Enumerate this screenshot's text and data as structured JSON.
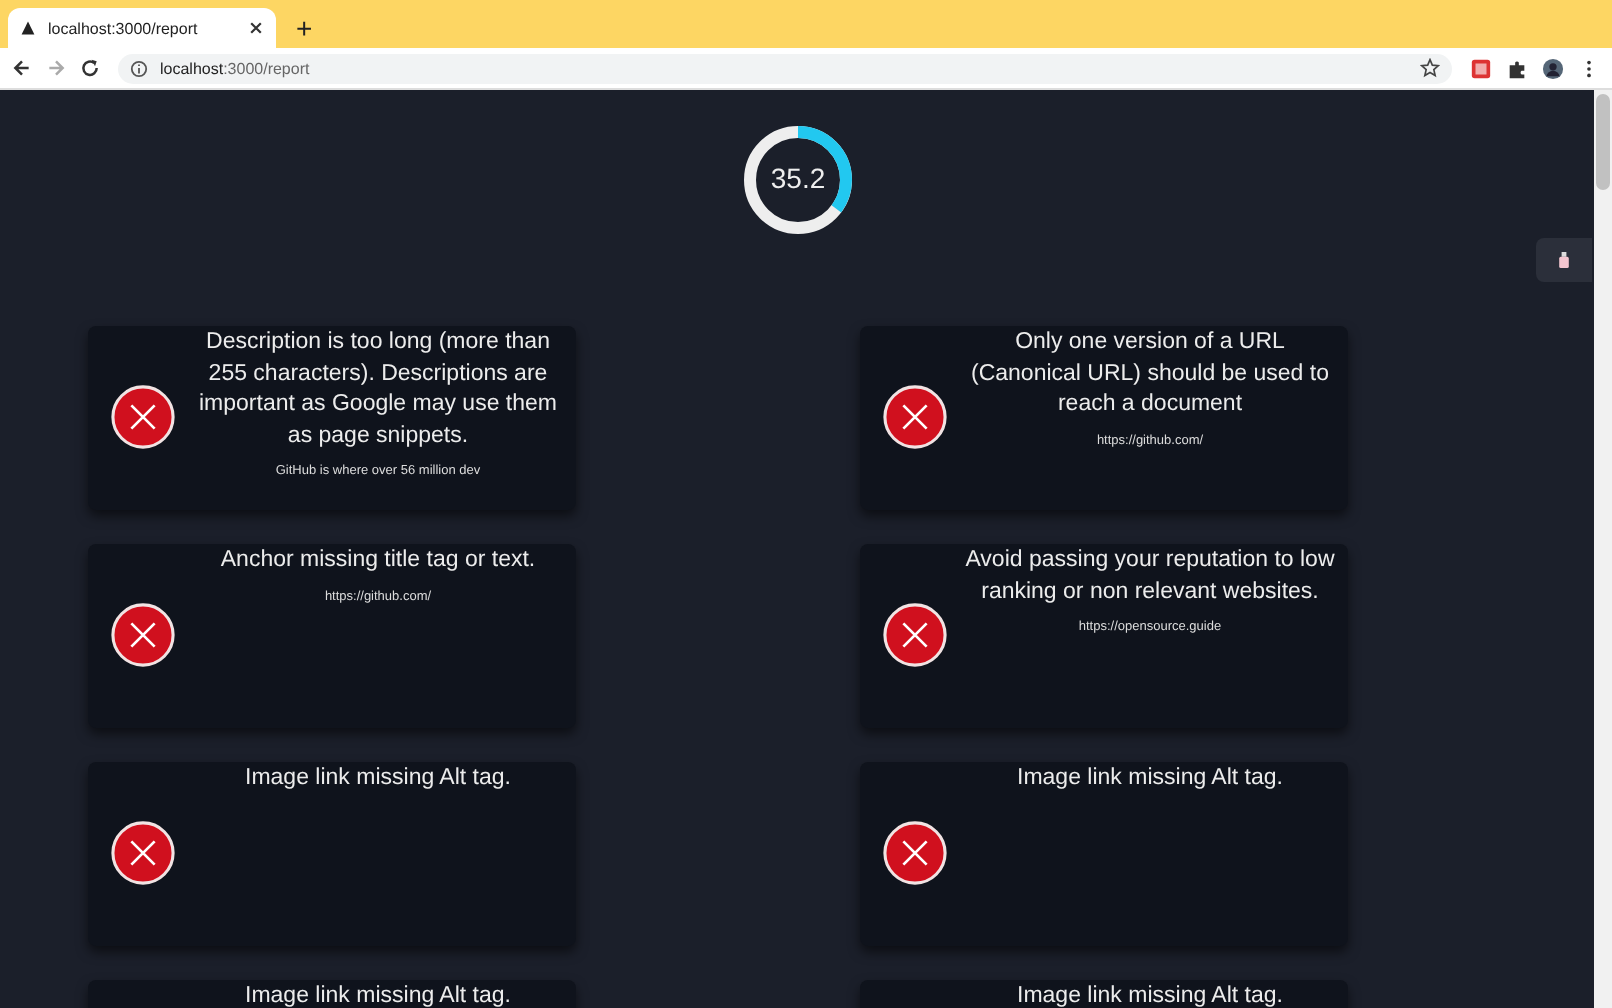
{
  "browser": {
    "tab": {
      "title": "localhost:3000/report",
      "selected": true
    },
    "new_tab": "+",
    "address": {
      "host": "localhost",
      "path": ":3000/report"
    }
  },
  "score": {
    "value": "35.2",
    "level": 0.352
  },
  "results": [
    {
      "message": "Description is too long (more than 255 characters). Descriptions are important as Google may use them as page snippets.",
      "detail": "GitHub is where over 56 million dev"
    },
    {
      "message": "Only one version of a URL (Canonical URL) should be used to reach a document",
      "detail": "https://github.com/"
    },
    {
      "message": "Anchor missing title tag or text.",
      "detail": "https://github.com/"
    },
    {
      "message": "Avoid passing your reputation to low ranking or non relevant websites.",
      "detail": "https://opensource.guide"
    },
    {
      "message": "Image link missing Alt tag."
    },
    {
      "message": "Image link missing Alt tag."
    },
    {
      "message": "Image link missing Alt tag."
    },
    {
      "message": "Image link missing Alt tag."
    }
  ]
}
